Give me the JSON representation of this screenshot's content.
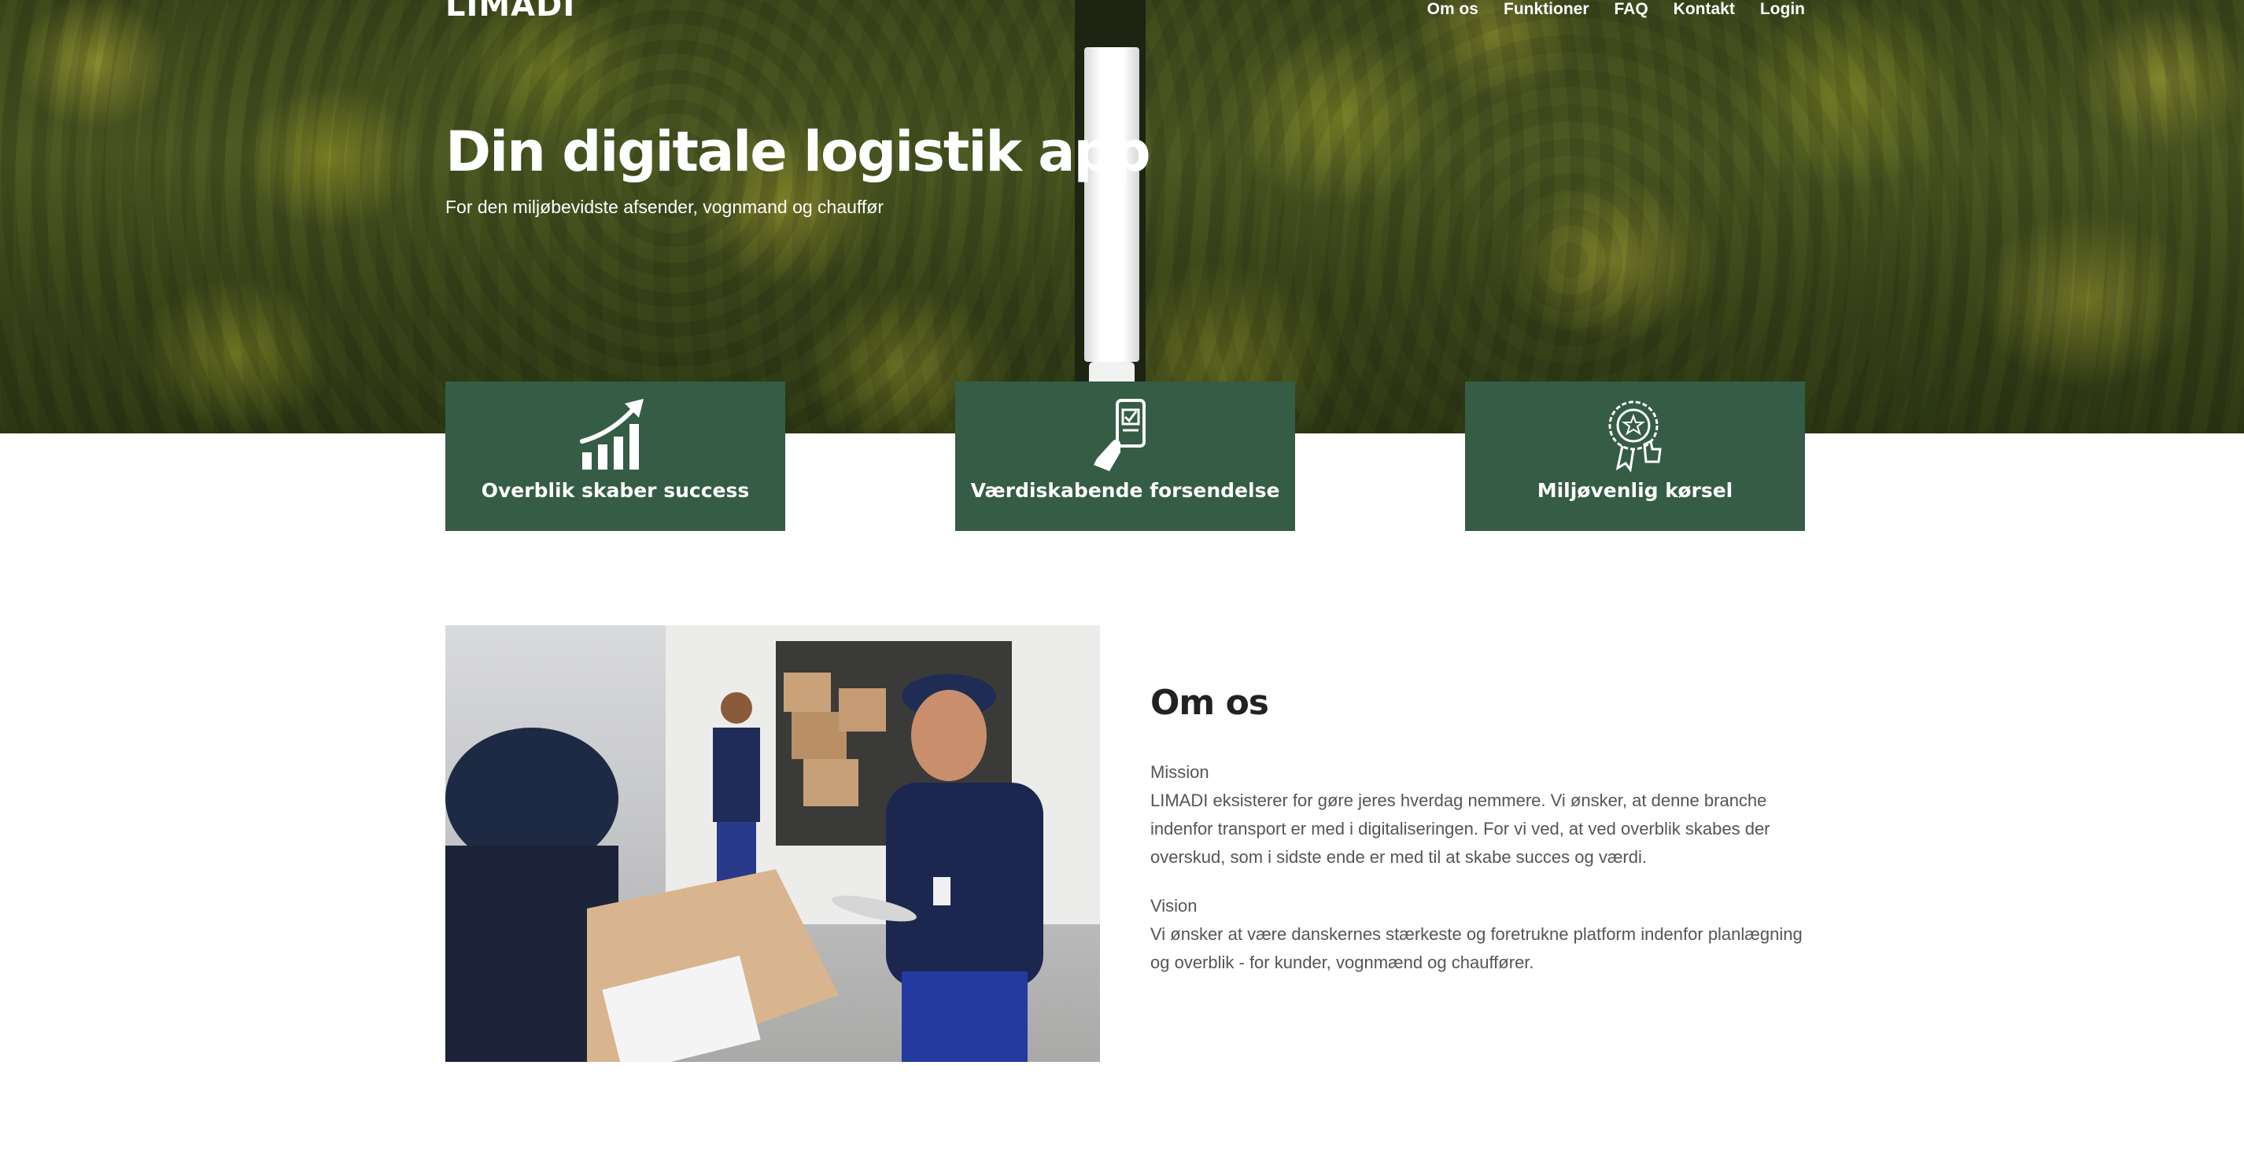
{
  "brand": {
    "logo": "LIMADI"
  },
  "nav": {
    "items": [
      "Om os",
      "Funktioner",
      "FAQ",
      "Kontakt",
      "Login"
    ]
  },
  "hero": {
    "title": "Din digitale logistik app",
    "subtitle": "For den miljøbevidste afsender, vognmand og chauffør"
  },
  "features": [
    {
      "label": "Overblik skaber success",
      "icon": "growth-chart-icon"
    },
    {
      "label": "Værdiskabende forsendelse",
      "icon": "phone-checklist-icon"
    },
    {
      "label": "Miljøvenlig kørsel",
      "icon": "award-badge-icon"
    }
  ],
  "about": {
    "title": "Om os",
    "mission_heading": "Mission",
    "mission_text": "LIMADI eksisterer for gøre jeres hverdag nemmere. Vi ønsker, at denne branche indenfor transport er med i digitaliseringen. For vi ved, at ved overblik skabes der overskud, som i sidste ende er med til at skabe succes og værdi.",
    "vision_heading": "Vision",
    "vision_text": "Vi ønsker at være danskernes stærkeste og foretrukne platform indenfor planlægning og overblik - for kunder, vognmænd og chauffører."
  },
  "colors": {
    "card_green": "#355c45",
    "heading_dark": "#222222",
    "body_text": "#555555"
  }
}
